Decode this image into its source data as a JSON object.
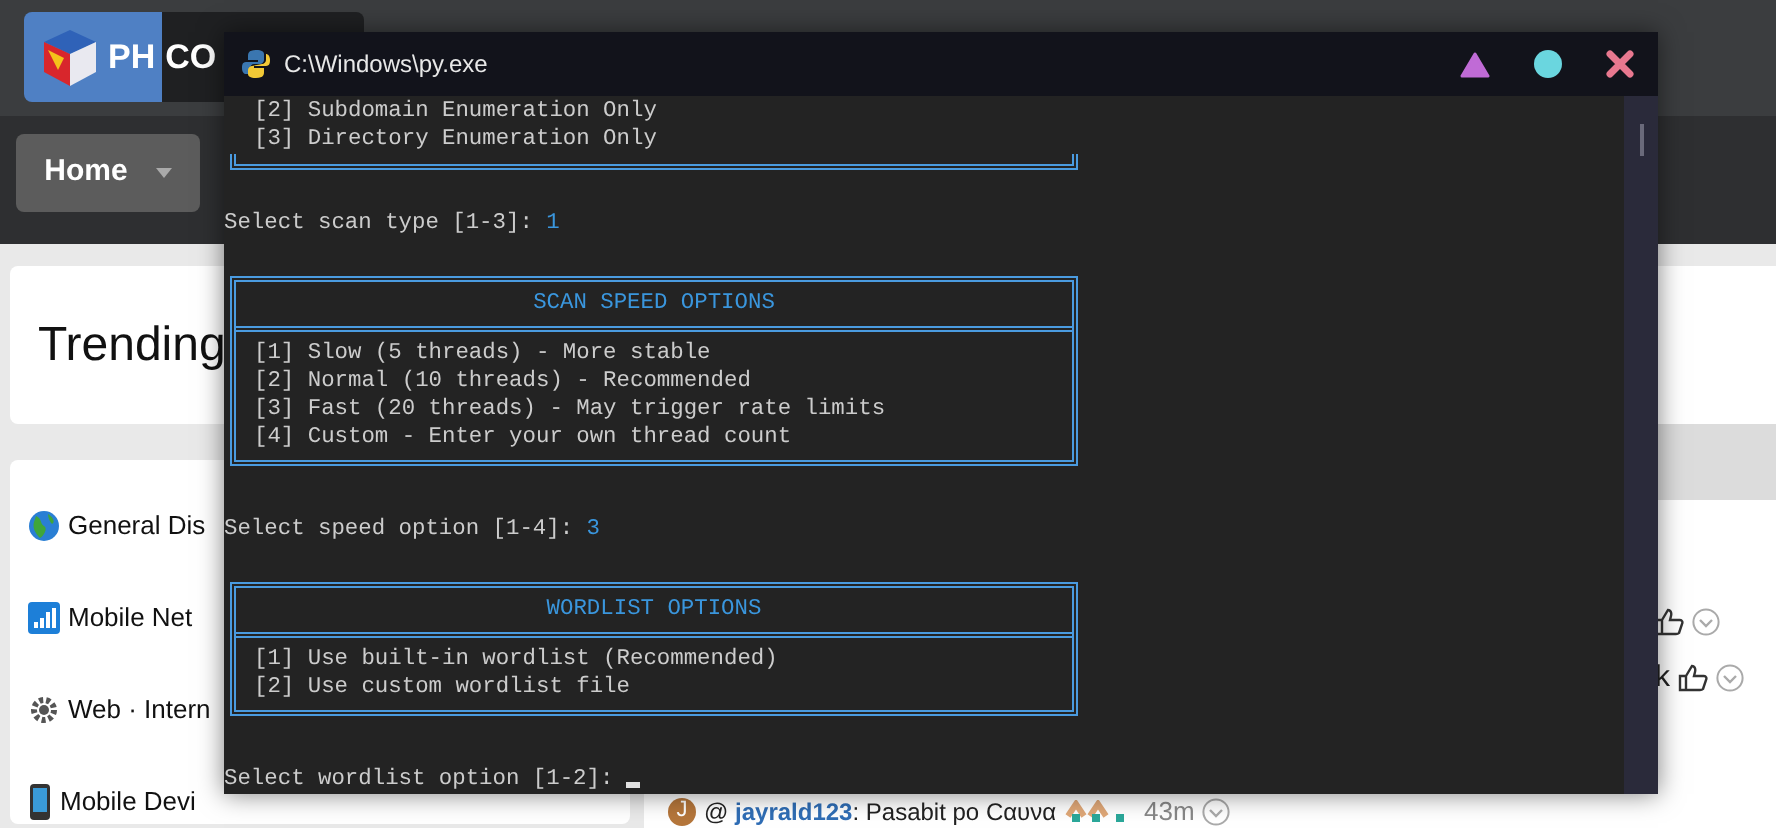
{
  "forum_page": {
    "logo": {
      "text_1": "PH",
      "text_2": "CO"
    },
    "nav": {
      "home": "Home"
    },
    "trending_title": "Trending",
    "categories": [
      {
        "label": "General Dis",
        "kind": "globe"
      },
      {
        "label": "Mobile Net",
        "kind": "signal"
      },
      {
        "label": "Web · Intern",
        "kind": "gear"
      },
      {
        "label": "Mobile Devi",
        "kind": "phone"
      }
    ],
    "shoutbox": {
      "messages": [
        {
          "kind": "reactions"
        },
        {
          "kind": "reactions",
          "text": "k"
        },
        {
          "kind": "message",
          "avatar": "J",
          "text": "@ **jayrald123**: Pasabit po Cαυνα",
          "time": "43m"
        }
      ]
    }
  },
  "console": {
    "title": "C:\\Windows\\py.exe",
    "lines": [
      {
        "kind": "output",
        "text": "[2] Subdomain Enumeration Only"
      },
      {
        "kind": "output",
        "text": "[3] Directory Enumeration Only"
      },
      {
        "kind": "frame_end"
      },
      {
        "kind": "blank"
      },
      {
        "kind": "prompt",
        "text": "Select scan type [1-3]: ",
        "answer": "1"
      },
      {
        "kind": "blank"
      },
      {
        "kind": "panel",
        "title": "SCAN SPEED OPTIONS",
        "options": [
          "[1] Slow (5 threads) - More stable",
          "[2] Normal (10 threads) - Recommended",
          "[3] Fast (20 threads) - May trigger rate limits",
          "[4] Custom - Enter your own thread count"
        ]
      },
      {
        "kind": "blank"
      },
      {
        "kind": "prompt",
        "text": "Select speed option [1-4]: ",
        "answer": "3"
      },
      {
        "kind": "blank"
      },
      {
        "kind": "panel",
        "title": "WORDLIST OPTIONS",
        "options": [
          "[1] Use built-in wordlist (Recommended)",
          "[2] Use custom wordlist file"
        ]
      },
      {
        "kind": "blank"
      },
      {
        "kind": "prompt",
        "text": "Select wordlist option [1-2]: ",
        "cursor": true
      }
    ]
  }
}
